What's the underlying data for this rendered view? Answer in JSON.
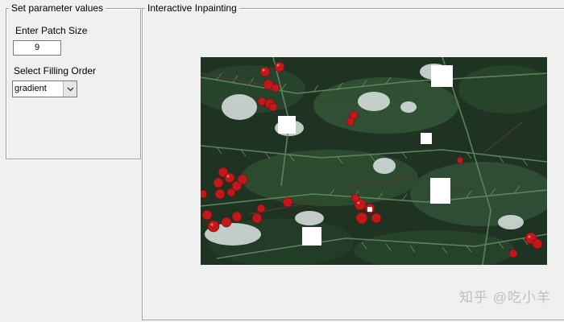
{
  "param_panel": {
    "title": "Set parameter values",
    "patch_size_label": "Enter Patch Size",
    "patch_size_value": "9",
    "filling_order_label": "Select Filling Order",
    "filling_order_value": "gradient"
  },
  "inpaint_panel": {
    "title": "Interactive Inpainting"
  },
  "image": {
    "description_colors": {
      "foliage_dark": "#1d2f1f",
      "foliage_green": "#4f7a52",
      "snow": "#e6ecea",
      "berry_red": "#c0191c",
      "mask": "#ffffff"
    }
  },
  "watermark": "知乎 @吃小羊"
}
